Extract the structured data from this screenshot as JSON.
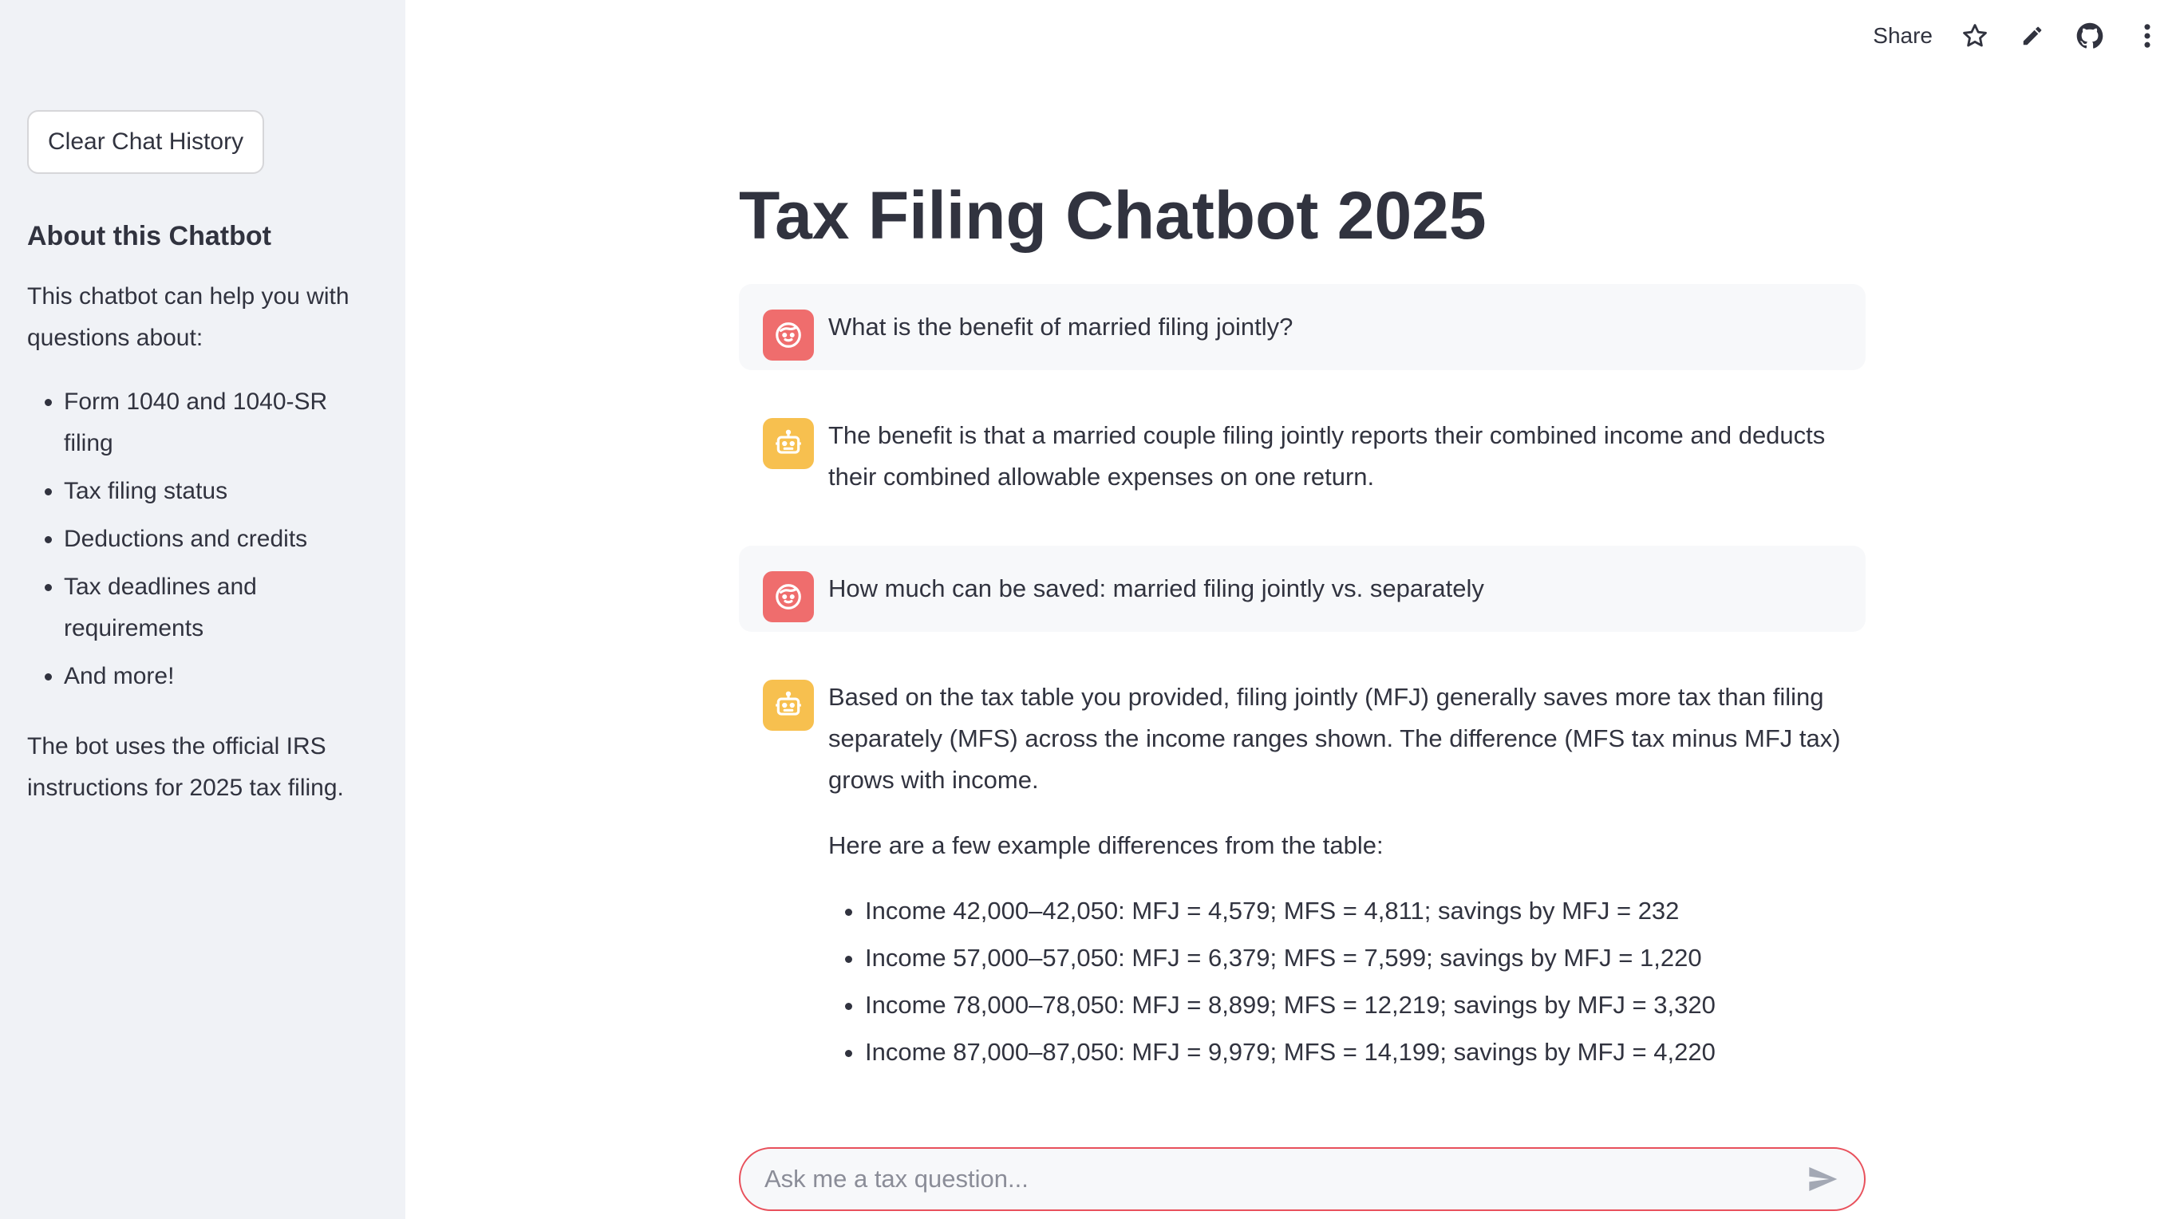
{
  "sidebar": {
    "clear_button": "Clear Chat History",
    "heading": "About this Chatbot",
    "intro": "This chatbot can help you with questions about:",
    "topics": [
      "Form 1040 and 1040-SR filing",
      "Tax filing status",
      "Deductions and credits",
      "Tax deadlines and requirements",
      "And more!"
    ],
    "footer": "The bot uses the official IRS instructions for 2025 tax filing."
  },
  "toolbar": {
    "share_label": "Share",
    "icons": [
      "star-icon",
      "pencil-icon",
      "github-icon",
      "more-vertical-icon"
    ]
  },
  "main": {
    "title": "Tax Filing Chatbot 2025"
  },
  "messages": [
    {
      "role": "user",
      "text": "What is the benefit of married filing jointly?"
    },
    {
      "role": "assistant",
      "text": "The benefit is that a married couple filing jointly reports their combined income and deducts their combined allowable expenses on one return."
    },
    {
      "role": "user",
      "text": "How much can be saved: married filing jointly vs. separately"
    },
    {
      "role": "assistant",
      "paragraph1": "Based on the tax table you provided, filing jointly (MFJ) generally saves more tax than filing separately (MFS) across the income ranges shown. The difference (MFS tax minus MFJ tax) grows with income.",
      "paragraph2": "Here are a few example differences from the table:",
      "examples": [
        "Income 42,000–42,050: MFJ = 4,579; MFS = 4,811; savings by MFJ = 232",
        "Income 57,000–57,050: MFJ = 6,379; MFS = 7,599; savings by MFJ = 1,220",
        "Income 78,000–78,050: MFJ = 8,899; MFS = 12,219; savings by MFJ = 3,320",
        "Income 87,000–87,050: MFJ = 9,979; MFS = 14,199; savings by MFJ = 4,220"
      ]
    }
  ],
  "chat_input": {
    "placeholder": "Ask me a tax question...",
    "value": ""
  },
  "colors": {
    "sidebar_bg": "#f0f2f6",
    "user_avatar": "#ef6d6d",
    "bot_avatar": "#f7c04f",
    "input_border": "#e8505b"
  }
}
